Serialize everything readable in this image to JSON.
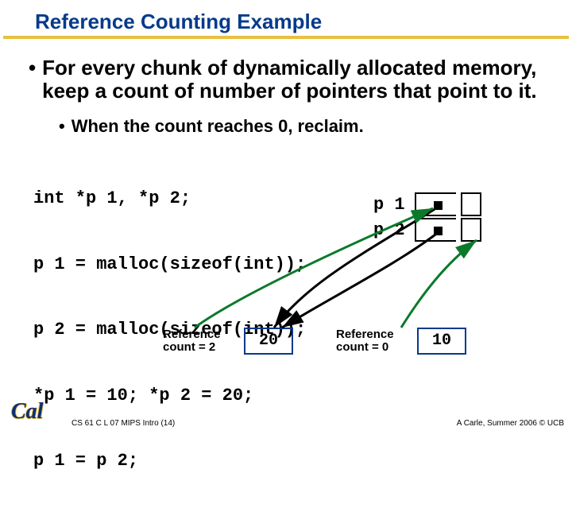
{
  "title": "Reference Counting Example",
  "bullet1": "For every chunk of dynamically allocated memory, keep a count of number of pointers that point to it.",
  "bullet2": "When the count reaches 0, reclaim.",
  "code": {
    "l1": "int *p 1, *p 2;",
    "l2": "p 1 = malloc(sizeof(int));",
    "l3": "p 2 = malloc(sizeof(int));",
    "l4": "*p 1 = 10; *p 2 = 20;",
    "l5": "p 1 = p 2;"
  },
  "diagram": {
    "p1_label": "p 1",
    "p2_label": "p 2",
    "rc_left_label": "Reference count = 2",
    "rc_right_label": "Reference count = 0",
    "val_left": "20",
    "val_right": "10"
  },
  "footer": {
    "logo": "Cal",
    "left": "CS 61 C L 07 MIPS Intro (14)",
    "right": "A Carle, Summer 2006 © UCB"
  }
}
